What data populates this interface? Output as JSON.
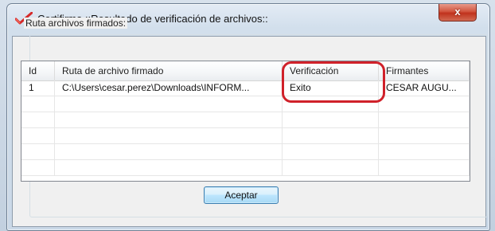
{
  "window": {
    "title": "Certifirma ::Resultado de verificación de archivos::",
    "close_label": "x"
  },
  "groupbox": {
    "label": "Ruta archivos firmados:"
  },
  "table": {
    "columns": [
      "Id",
      "Ruta de archivo firmado",
      "Verificación",
      "Firmantes"
    ],
    "rows": [
      [
        "1",
        "C:\\Users\\cesar.perez\\Downloads\\INFORM...",
        "Exito",
        "CESAR AUGU..."
      ]
    ],
    "empty_rows": 5
  },
  "buttons": {
    "accept_label": "Aceptar"
  },
  "colors": {
    "highlight": "#d0212a",
    "close_button": "#c0321d",
    "button_border": "#3c7fb1"
  },
  "icons": {
    "app_icon": "red-checkmark-icon",
    "close_icon": "close-icon"
  }
}
